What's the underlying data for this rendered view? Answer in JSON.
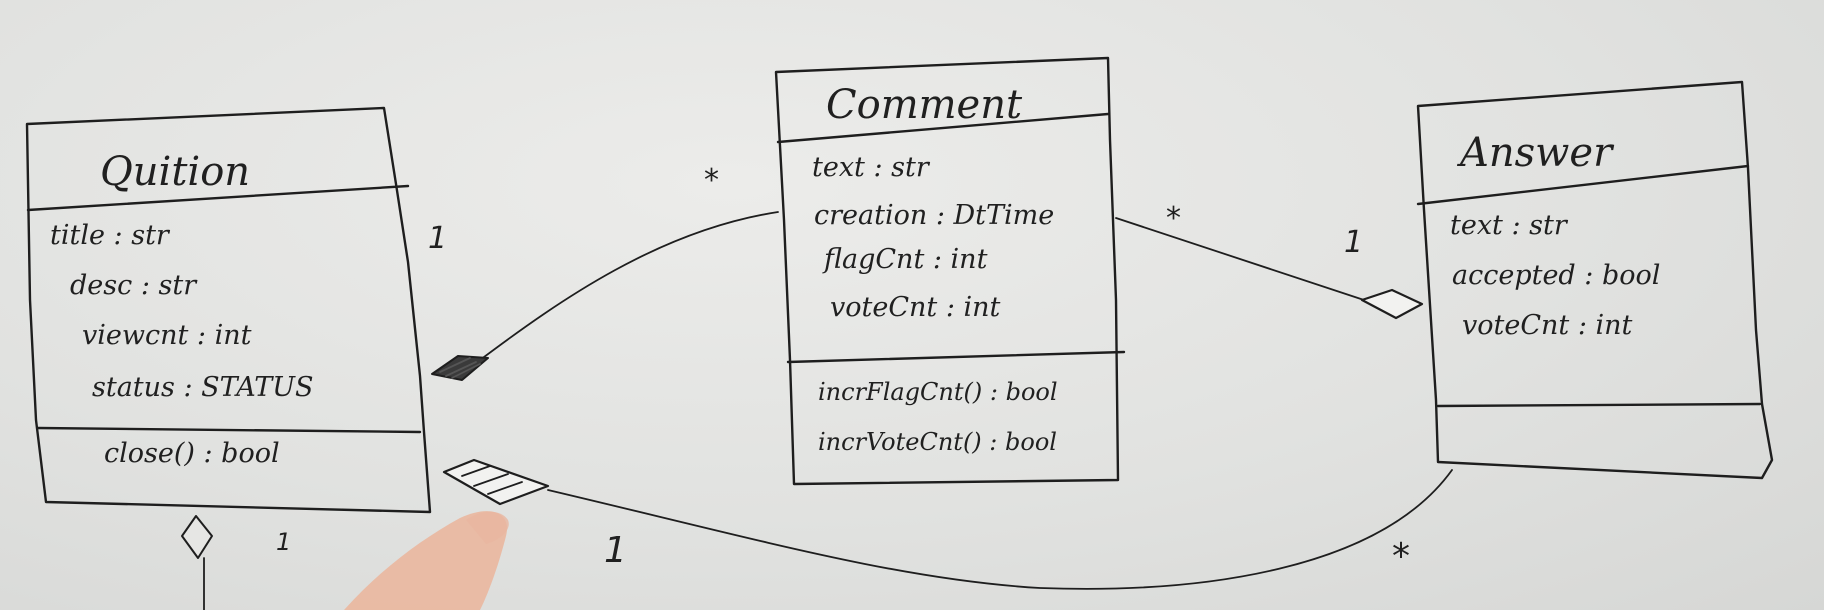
{
  "diagram": {
    "classes": {
      "question": {
        "name": "Quition",
        "attributes": [
          "title : str",
          "desc : str",
          "viewcnt : int",
          "status : STATUS"
        ],
        "methods": [
          "close() : bool"
        ]
      },
      "comment": {
        "name": "Comment",
        "attributes": [
          "text : str",
          "creation : DtTime",
          "flagCnt : int",
          "voteCnt : int"
        ],
        "methods": [
          "incrFlagCnt() : bool",
          "incrVoteCnt() : bool"
        ]
      },
      "answer": {
        "name": "Answer",
        "attributes": [
          "text : str",
          "accepted : bool",
          "voteCnt : int"
        ],
        "methods": []
      }
    },
    "multiplicities": {
      "question_comment_question_end": "1",
      "question_comment_comment_end": "*",
      "comment_answer_comment_end": "*",
      "comment_answer_answer_end": "1",
      "question_answer_question_end": "1",
      "question_answer_answer_end": "*",
      "question_bottom": "1"
    }
  }
}
